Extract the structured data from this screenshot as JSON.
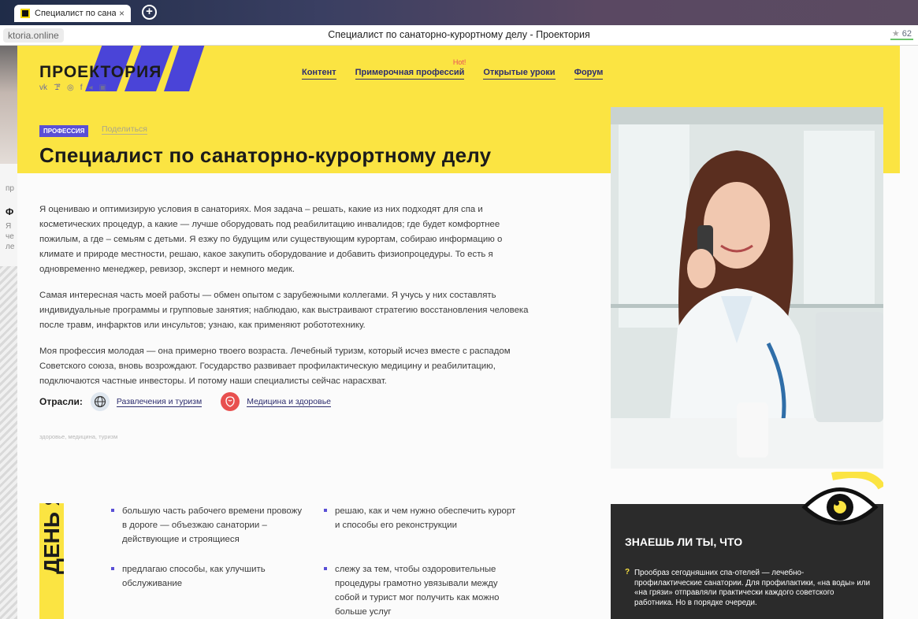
{
  "browser": {
    "tab_title": "Специалист по санатор",
    "tab_close": "×",
    "new_tab": "+",
    "url": "ktoria.online",
    "page_title": "Специалист по санаторно-курортному делу - Проектория",
    "rating_star": "★",
    "rating": "62"
  },
  "sliver": {
    "t1": "пр",
    "t2": "Ф",
    "t3": "Я",
    "t4": "че",
    "t5": "ле"
  },
  "header": {
    "logo": "ПРОЕКТОРИЯ",
    "socials": [
      "vk-icon",
      "ok-icon",
      "instagram-icon",
      "facebook-icon",
      "telegram-icon",
      "youtube-icon"
    ],
    "nav": [
      "Контент",
      "Примерочная профессий",
      "Открытые уроки",
      "Форум"
    ],
    "hot_label": "Hot!"
  },
  "profession": {
    "badge": "ПРОФЕССИЯ",
    "share": "Поделиться",
    "title": "Специалист по санаторно-курортному делу",
    "paragraphs": [
      "Я оцениваю и оптимизирую условия в санаториях. Моя задача – решать, какие из них подходят для спа и косметических процедур, а какие — лучше оборудовать под реабилитацию инвалидов; где будет комфортнее пожилым, а где – семьям с детьми. Я езжу по будущим или существующим курортам, собираю информацию о климате и природе местности, решаю, какое закупить оборудование и добавить физиопроцедуры. То есть я одновременно менеджер, ревизор, эксперт и немного медик.",
      "Самая интересная часть моей работы — обмен опытом с зарубежными коллегами. Я учусь у них составлять индивидуальные программы и групповые занятия; наблюдаю, как выстраивают стратегию восстановления человека после травм, инфарктов или инсультов; узнаю, как применяют робототехнику.",
      "Моя профессия молодая — она примерно твоего возраста. Лечебный туризм, который исчез вместе с распадом Советского союза, вновь возрождают. Государство развивает профилактическую медицину и реабилитацию, подключаются частные инвесторы. И потому наши специалисты сейчас нарасхват."
    ],
    "sectors_label": "Отрасли:",
    "sectors": [
      "Развлечения и туризм",
      "Медицина и здоровье"
    ],
    "tags": "здоровье, медицина, туризм"
  },
  "day": {
    "band_text": "ДЕНЬ Я",
    "tasks": [
      "большую часть рабочего времени провожу в дороге — объезжаю санатории – действующие и строящиеся",
      "решаю, как и чем нужно обеспечить курорт и способы его реконструкции",
      "предлагаю способы, как улучшить обслуживание",
      "слежу за тем, чтобы оздоровительные процедуры грамотно увязывали между собой и турист мог получить как можно больше услуг"
    ]
  },
  "fact": {
    "title": "ЗНАЕШЬ ЛИ ТЫ, ЧТО",
    "mark": "?",
    "text": "Прообраз сегодняшних спа-отелей — лечебно-профилактические санатории. Для профилактики, «на воды» или «на грязи» отправляли практически каждого советского работника. Но в порядке очереди."
  },
  "colors": {
    "yellow": "#fbe442",
    "purple": "#5a4fd6",
    "dark": "#2b2b2b",
    "nav": "#2d2d6e"
  }
}
